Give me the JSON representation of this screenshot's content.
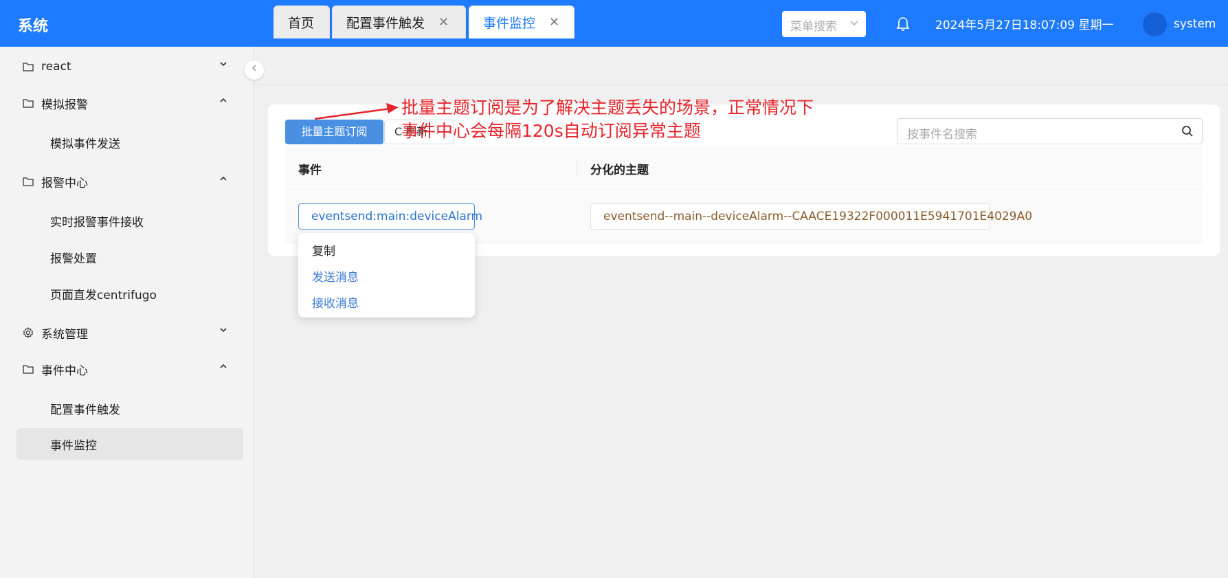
{
  "header": {
    "logo": "系统",
    "menu_search_placeholder": "菜单搜索",
    "datetime": "2024年5月27日18:07:09 星期一",
    "username": "system"
  },
  "sidebar": {
    "items": [
      {
        "label": "react",
        "icon": "folder-icon",
        "expanded": false
      },
      {
        "label": "模拟报警",
        "icon": "folder-icon",
        "expanded": true
      },
      {
        "label": "模拟事件发送"
      },
      {
        "label": "报警中心",
        "icon": "folder-icon",
        "expanded": true
      },
      {
        "label": "实时报警事件接收"
      },
      {
        "label": "报警处置"
      },
      {
        "label": "页面直发centrifugo"
      },
      {
        "label": "系统管理",
        "icon": "gear-icon",
        "expanded": false
      },
      {
        "label": "事件中心",
        "icon": "folder-icon",
        "expanded": true
      },
      {
        "label": "配置事件触发"
      },
      {
        "label": "事件监控",
        "active": true
      }
    ]
  },
  "tabs": [
    {
      "label": "首页"
    },
    {
      "label": "配置事件触发",
      "closable": true
    },
    {
      "label": "事件监控",
      "closable": true,
      "active": true
    }
  ],
  "toolbar": {
    "batch_subscribe_label": "批量主题订阅",
    "second_button_label": "C 刷新",
    "search_placeholder": "按事件名搜索"
  },
  "table": {
    "columns": [
      "事件",
      "分化的主题"
    ],
    "rows": [
      {
        "event": "eventsend:main:deviceAlarm",
        "topic": "eventsend--main--deviceAlarm--CAACE19322F000011E5941701E4029A0"
      }
    ]
  },
  "context_menu": {
    "items": [
      "复制",
      "发送消息",
      "接收消息"
    ]
  },
  "annotation": {
    "line1": "批量主题订阅是为了解决主题丢失的场景，正常情况下",
    "line2": "事件中心会每隔120s自动订阅异常主题"
  },
  "colors": {
    "header_bg": "#1e7bff",
    "primary": "#4a90e2",
    "annotation": "#e8232a",
    "topic_text": "#8b5a2b"
  }
}
